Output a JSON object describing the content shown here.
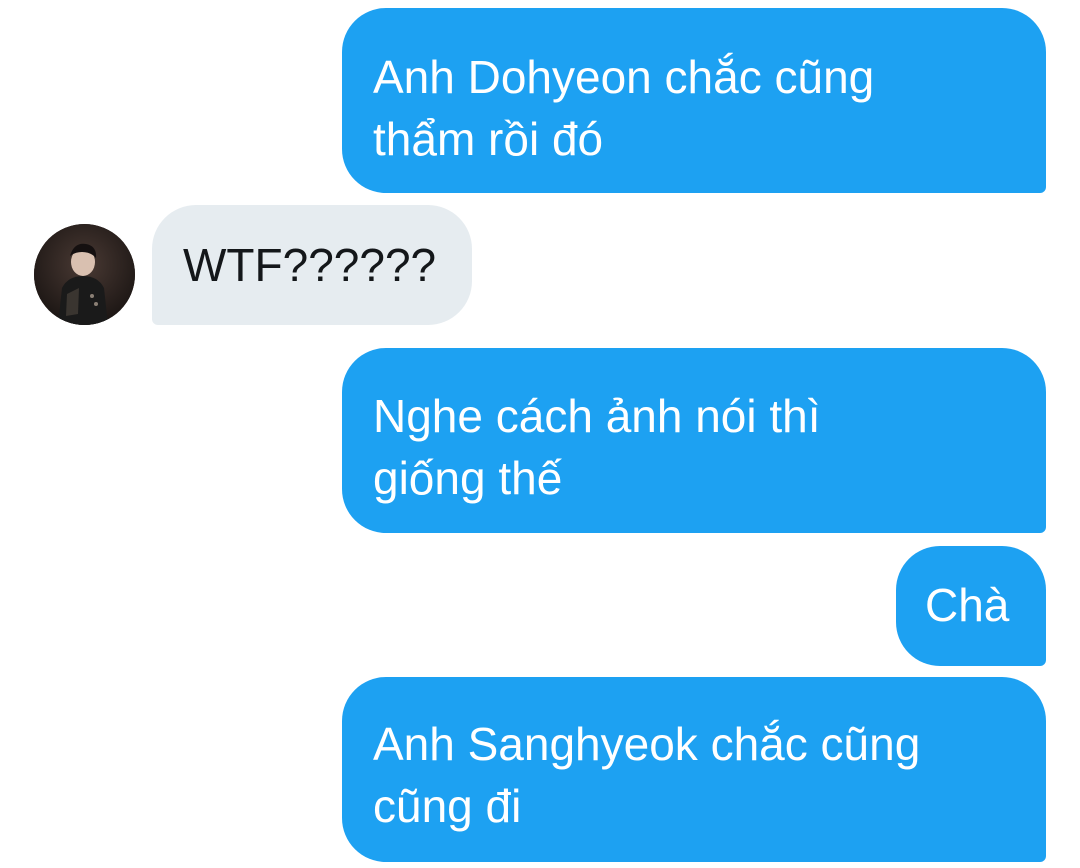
{
  "conversation": {
    "messages": [
      {
        "sender": "me",
        "text": "Anh Dohyeon chắc cũng\nthẩm rồi đó"
      },
      {
        "sender": "contact",
        "text": "WTF??????"
      },
      {
        "sender": "me",
        "text": "Nghe cách ảnh nói thì\ngiống thế"
      },
      {
        "sender": "me",
        "text": "Chà"
      },
      {
        "sender": "me",
        "text": "Anh Sanghyeok chắc cũng\ncũng đi"
      }
    ]
  },
  "contact": {
    "avatar_icon": "user-avatar-photo"
  },
  "colors": {
    "sent_bubble": "#1da1f2",
    "received_bubble": "#e6ecf0",
    "sent_text": "#ffffff",
    "received_text": "#14171a",
    "background": "#ffffff"
  }
}
